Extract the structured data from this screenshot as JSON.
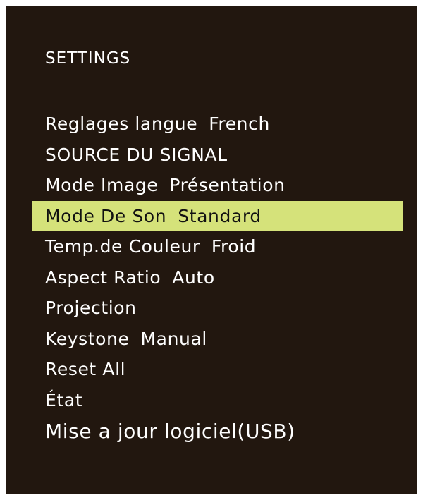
{
  "menu": {
    "title": "SETTINGS",
    "items": [
      {
        "label": "Reglages langue",
        "value": "French"
      },
      {
        "label": "SOURCE DU SIGNAL",
        "value": ""
      },
      {
        "label": "Mode Image",
        "value": "Présentation"
      },
      {
        "label": "Mode De Son",
        "value": "Standard"
      },
      {
        "label": "Temp.de Couleur",
        "value": "Froid"
      },
      {
        "label": "Aspect Ratio",
        "value": "Auto"
      },
      {
        "label": "Projection",
        "value": ""
      },
      {
        "label": "Keystone",
        "value": "Manual"
      },
      {
        "label": "Reset All",
        "value": ""
      },
      {
        "label": "État",
        "value": ""
      },
      {
        "label": "Mise a jour logiciel(USB)",
        "value": ""
      }
    ],
    "selected_index": 3
  },
  "colors": {
    "background": "#22170f",
    "text": "#ffffff",
    "highlight": "#d5e27a",
    "highlight_text": "#111111"
  }
}
